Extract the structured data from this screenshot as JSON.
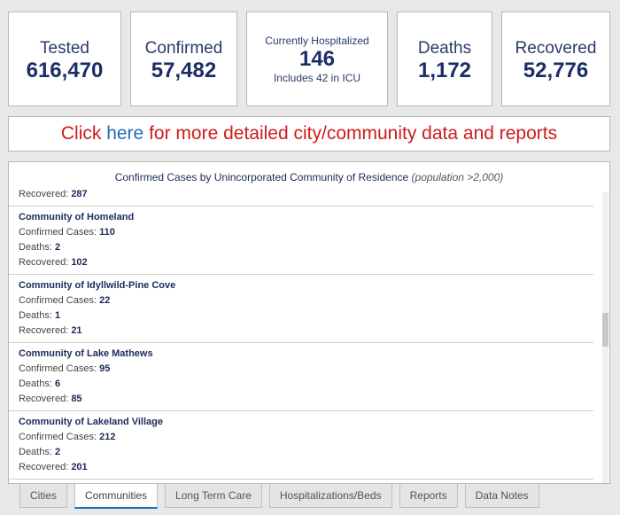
{
  "stats": {
    "tested": {
      "label": "Tested",
      "value": "616,470"
    },
    "confirmed": {
      "label": "Confirmed",
      "value": "57,482"
    },
    "hospitalized": {
      "label": "Currently Hospitalized",
      "value": "146",
      "sub": "Includes 42 in ICU"
    },
    "deaths": {
      "label": "Deaths",
      "value": "1,172"
    },
    "recovered": {
      "label": "Recovered",
      "value": "52,776"
    }
  },
  "banner": {
    "prefix": "Click ",
    "link": "here",
    "suffix": " for more detailed city/community data and reports"
  },
  "panel": {
    "title": "Confirmed Cases by Unincorporated Community of Residence ",
    "title_note": "(population >2,000)",
    "partial": {
      "label": "Recovered: ",
      "value": "287"
    },
    "labels": {
      "confirmed": "Confirmed Cases: ",
      "deaths": "Deaths: ",
      "recovered": "Recovered: "
    },
    "items": [
      {
        "name": "Community of Homeland",
        "confirmed": "110",
        "deaths": "2",
        "recovered": "102"
      },
      {
        "name": "Community of Idyllwild-Pine Cove",
        "confirmed": "22",
        "deaths": "1",
        "recovered": "21"
      },
      {
        "name": "Community of Lake Mathews",
        "confirmed": "95",
        "deaths": "6",
        "recovered": "85"
      },
      {
        "name": "Community of Lakeland Village",
        "confirmed": "212",
        "deaths": "2",
        "recovered": "201"
      }
    ]
  },
  "tabs": [
    {
      "label": "Cities",
      "active": false
    },
    {
      "label": "Communities",
      "active": true
    },
    {
      "label": "Long Term Care",
      "active": false
    },
    {
      "label": "Hospitalizations/Beds",
      "active": false
    },
    {
      "label": "Reports",
      "active": false
    },
    {
      "label": "Data Notes",
      "active": false
    }
  ]
}
